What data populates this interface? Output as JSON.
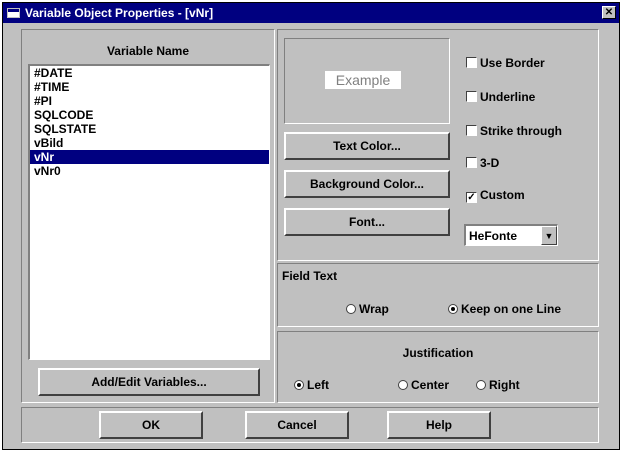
{
  "window": {
    "title": "Variable Object Properties - [vNr]"
  },
  "variables": {
    "header": "Variable Name",
    "items": [
      "#DATE",
      "#TIME",
      "#PI",
      "SQLCODE",
      "SQLSTATE",
      "vBild",
      "vNr",
      "vNr0"
    ],
    "selected": "vNr",
    "add_edit_label": "Add/Edit Variables..."
  },
  "preview": {
    "example_text": "Example"
  },
  "buttons": {
    "text_color": "Text Color...",
    "background_color": "Background Color...",
    "font": "Font..."
  },
  "options": {
    "use_border": {
      "label": "Use Border",
      "checked": false
    },
    "underline": {
      "label": "Underline",
      "checked": false
    },
    "strike_through": {
      "label": "Strike through",
      "checked": false
    },
    "three_d": {
      "label": "3-D",
      "checked": false
    },
    "custom": {
      "label": "Custom",
      "checked": true
    }
  },
  "font_select": {
    "value": "HeFonte"
  },
  "field_text": {
    "header": "Field Text",
    "wrap": {
      "label": "Wrap",
      "selected": false
    },
    "keep_one_line": {
      "label": "Keep on one Line",
      "selected": true
    }
  },
  "justification": {
    "header": "Justification",
    "left": {
      "label": "Left",
      "selected": true
    },
    "center": {
      "label": "Center",
      "selected": false
    },
    "right": {
      "label": "Right",
      "selected": false
    }
  },
  "footer": {
    "ok": "OK",
    "cancel": "Cancel",
    "help": "Help"
  },
  "colors": {
    "titlebar": "#000080",
    "face": "#c0c0c0",
    "selection": "#000080"
  }
}
